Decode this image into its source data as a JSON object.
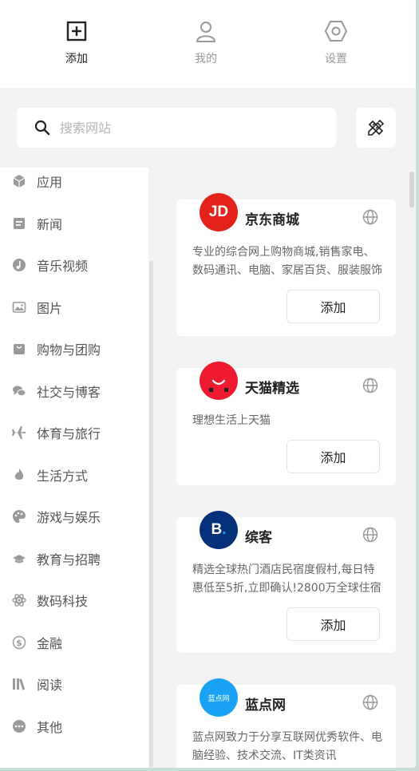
{
  "nav": {
    "tabs": [
      {
        "label": "添加",
        "icon": "plus-square-icon",
        "active": true
      },
      {
        "label": "我的",
        "icon": "user-icon",
        "active": false
      },
      {
        "label": "设置",
        "icon": "hexagon-settings-icon",
        "active": false
      }
    ]
  },
  "search": {
    "placeholder": "搜索网站",
    "value": ""
  },
  "toolbar": {
    "tool_icon": "pencil-ruler-icon"
  },
  "sidebar": {
    "items": [
      {
        "label": "应用",
        "icon": "box-icon"
      },
      {
        "label": "新闻",
        "icon": "news-icon"
      },
      {
        "label": "音乐视频",
        "icon": "music-icon"
      },
      {
        "label": "图片",
        "icon": "image-icon"
      },
      {
        "label": "购物与团购",
        "icon": "shopping-bag-icon"
      },
      {
        "label": "社交与博客",
        "icon": "chat-icon"
      },
      {
        "label": "体育与旅行",
        "icon": "plane-icon"
      },
      {
        "label": "生活方式",
        "icon": "flame-icon"
      },
      {
        "label": "游戏与娱乐",
        "icon": "palette-icon"
      },
      {
        "label": "教育与招聘",
        "icon": "graduation-cap-icon"
      },
      {
        "label": "数码科技",
        "icon": "atom-icon"
      },
      {
        "label": "金融",
        "icon": "dollar-icon"
      },
      {
        "label": "阅读",
        "icon": "books-icon"
      },
      {
        "label": "其他",
        "icon": "more-icon"
      }
    ]
  },
  "sites": [
    {
      "name": "京东商城",
      "logo_text": "JD",
      "logo_color": "#e4231a",
      "description": "专业的综合网上购物商城,销售家电、数码通讯、电脑、家居百货、服装服饰",
      "add_label": "添加"
    },
    {
      "name": "天猫精选",
      "logo_text": "",
      "logo_color": "#ee1a2f",
      "description": "理想生活上天猫",
      "add_label": "添加"
    },
    {
      "name": "缤客",
      "logo_text": "B.",
      "logo_color": "#05317a",
      "description": "精选全球热门酒店民宿度假村,每日特惠低至5折,立即确认!2800万全球住宿",
      "add_label": "添加"
    },
    {
      "name": "蓝点网",
      "logo_text": "蓝点网",
      "logo_color": "#1aa3f4",
      "description": "蓝点网致力于分享互联网优秀软件、电脑经验、技术交流、IT类资讯",
      "add_label": ""
    }
  ]
}
